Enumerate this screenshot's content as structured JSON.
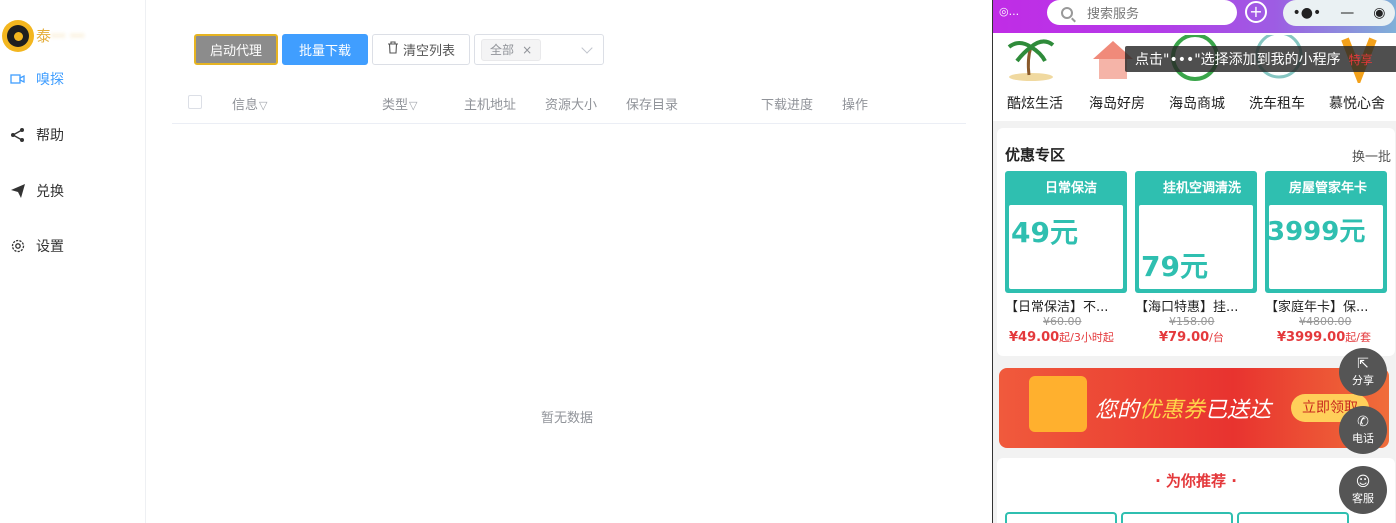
{
  "app": {
    "name": "泰",
    "name_blurred": "··· ···"
  },
  "sidebar": {
    "items": [
      {
        "label": "嗅探",
        "icon": "camera-icon",
        "active": true
      },
      {
        "label": "帮助",
        "icon": "share-icon",
        "active": false
      },
      {
        "label": "兑换",
        "icon": "paper-plane-icon",
        "active": false
      },
      {
        "label": "设置",
        "icon": "gear-icon",
        "active": false
      }
    ]
  },
  "toolbar": {
    "start_proxy": "启动代理",
    "batch_download": "批量下载",
    "clear_list": "清空列表",
    "filter_tag": "全部",
    "filter_tag_close": "×"
  },
  "table": {
    "columns": [
      "信息",
      "类型",
      "主机地址",
      "资源大小",
      "保存目录",
      "下载进度",
      "操作"
    ],
    "filter_glyph": "▽",
    "empty_text": "暂无数据"
  },
  "mini_program": {
    "status_dots": "◎...",
    "search_placeholder": "搜索服务",
    "plus": "+",
    "capsule": {
      "more": "•●•",
      "minimize": "—",
      "close": "◉"
    },
    "tip": "点击\"•••\"选择添加到我的小程序",
    "tip_suffix": "特享",
    "icons": [
      {
        "label": "酷炫生活",
        "icon": "palm-tree-icon"
      },
      {
        "label": "海岛好房",
        "icon": "house-icon"
      },
      {
        "label": "海岛商城",
        "icon": "shop-icon"
      },
      {
        "label": "洗车租车",
        "icon": "car-icon"
      },
      {
        "label": "慕悦心舍",
        "icon": "home-v-icon"
      }
    ],
    "deals": {
      "title": "优惠专区",
      "more": "换一批",
      "products": [
        {
          "img_title": "日常保洁",
          "img_big": "49元",
          "name": "【日常保洁】不...",
          "original": "¥60.00",
          "price": "¥49.00",
          "unit": "起/3小时起"
        },
        {
          "img_title": "挂机空调清洗",
          "img_big": "79元",
          "name": "【海口特惠】挂...",
          "original": "¥158.00",
          "price": "¥79.00",
          "unit": "/台"
        },
        {
          "img_title": "房屋管家年卡",
          "img_big": "3999元",
          "name": "【家庭年卡】保...",
          "original": "¥4800.00",
          "price": "¥3999.00",
          "unit": "起/套"
        }
      ]
    },
    "banner": {
      "text_prefix": "您的",
      "text_highlight": "优惠券",
      "text_suffix": "已送达",
      "button": "立即领取"
    },
    "recommend": "· 为你推荐 ·",
    "float_buttons": [
      {
        "label": "分享",
        "icon": "share-out-icon",
        "glyph": "⇱"
      },
      {
        "label": "电话",
        "icon": "phone-icon",
        "glyph": "✆"
      },
      {
        "label": "客服",
        "icon": "customer-service-icon",
        "glyph": "☺"
      }
    ],
    "colors": {
      "accent": "#2fbfb0",
      "price": "#e4393c",
      "topbar": "#c02ce6"
    }
  }
}
